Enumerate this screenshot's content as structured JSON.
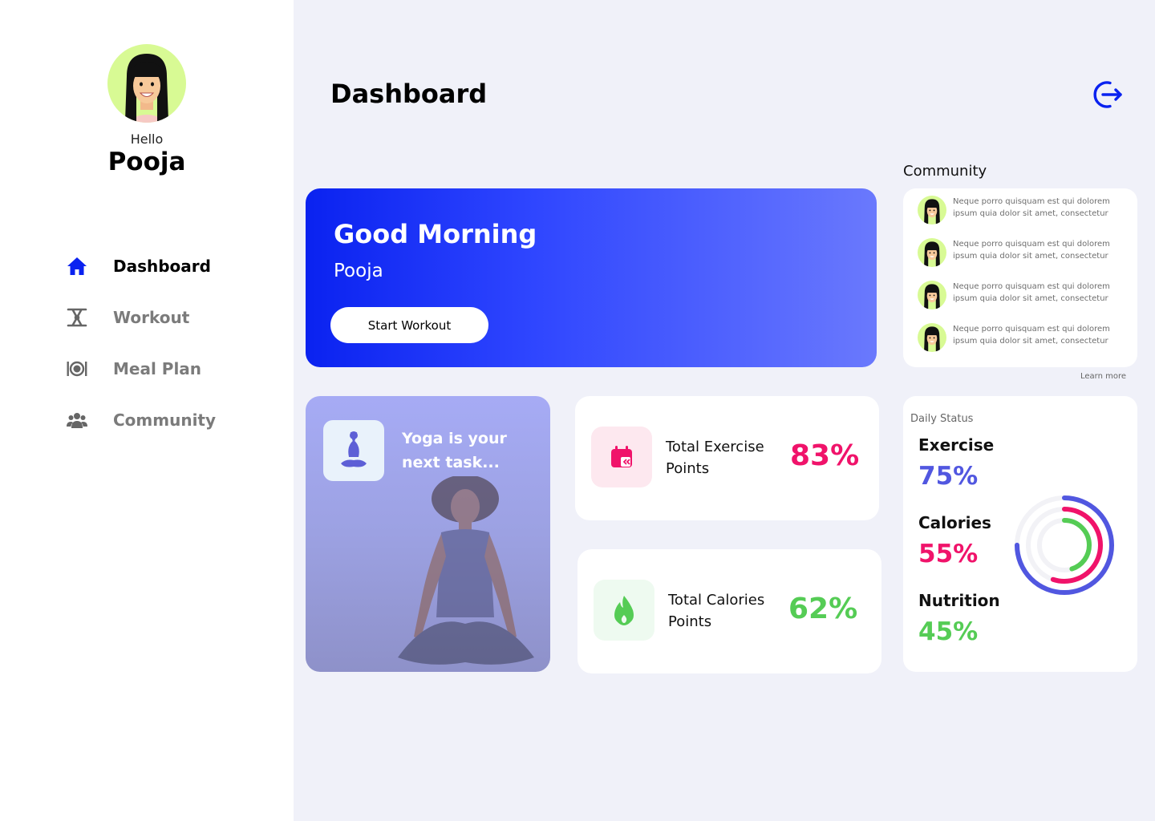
{
  "user": {
    "greeting": "Hello",
    "name": "Pooja"
  },
  "sidebar": {
    "items": [
      {
        "label": "Dashboard",
        "icon": "home-icon",
        "active": true
      },
      {
        "label": "Workout",
        "icon": "workout-icon",
        "active": false
      },
      {
        "label": "Meal Plan",
        "icon": "meal-icon",
        "active": false
      },
      {
        "label": "Community",
        "icon": "community-icon",
        "active": false
      }
    ]
  },
  "header": {
    "title": "Dashboard",
    "logout_icon": "logout-icon"
  },
  "hero": {
    "title": "Good Morning",
    "name": "Pooja",
    "button_label": "Start Workout"
  },
  "community": {
    "title": "Community",
    "posts": [
      {
        "text": "Neque porro quisquam est qui dolorem ipsum quia dolor sit amet, consectetur"
      },
      {
        "text": "Neque porro quisquam est qui dolorem ipsum quia dolor sit amet, consectetur"
      },
      {
        "text": "Neque porro quisquam est qui dolorem ipsum quia dolor sit amet, consectetur"
      },
      {
        "text": "Neque porro quisquam est qui dolorem ipsum quia dolor sit amet, consectetur"
      }
    ],
    "learn_more": "Learn more"
  },
  "task": {
    "text": "Yoga is your next task..."
  },
  "stats": {
    "exercise": {
      "label": "Total Exercise Points",
      "value": "83%",
      "color": "#f0136a"
    },
    "calories": {
      "label": "Total Calories Points",
      "value": "62%",
      "color": "#55cc55"
    }
  },
  "daily_status": {
    "title": "Daily Status",
    "items": [
      {
        "label": "Exercise",
        "value": "75%",
        "fraction": 0.75,
        "color": "#5157e0"
      },
      {
        "label": "Calories",
        "value": "55%",
        "fraction": 0.55,
        "color": "#f0136a"
      },
      {
        "label": "Nutrition",
        "value": "45%",
        "fraction": 0.45,
        "color": "#55cc55"
      }
    ]
  },
  "colors": {
    "accent": "#0a22f0",
    "sidebar_bg": "#ffffff",
    "page_bg": "#f0f1f9"
  }
}
